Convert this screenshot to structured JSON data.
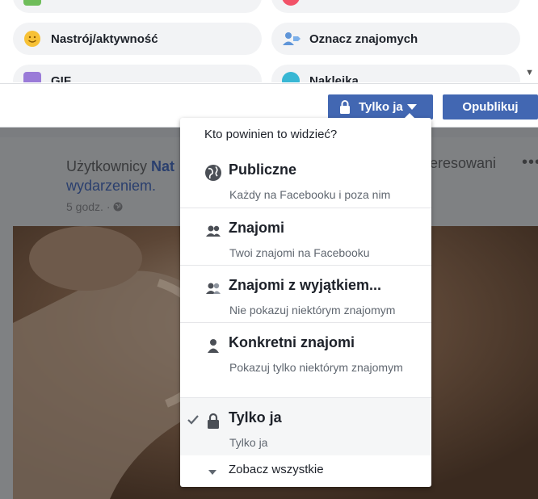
{
  "composer": {
    "options": [
      {
        "label": "",
        "icon": "activity-icon-partial"
      },
      {
        "label": "",
        "icon": "location-icon-partial"
      },
      {
        "label": "Nastrój/aktywność",
        "icon": "smiley-icon"
      },
      {
        "label": "Oznacz znajomych",
        "icon": "tag-friends-icon"
      },
      {
        "label": "GIF",
        "icon": "gif-icon"
      },
      {
        "label": "Naklejka",
        "icon": "sticker-icon"
      }
    ],
    "privacy_label": "Tylko ja",
    "publish_label": "Opublikuj"
  },
  "post": {
    "prefix": "Użytkownicy",
    "name_partial": "Nat",
    "suffix_partial": "eresowani",
    "line2": "wydarzeniem.",
    "time": "5 godz. ·"
  },
  "dropdown": {
    "header": "Kto powinien to widzieć?",
    "items": [
      {
        "title": "Publiczne",
        "desc": "Każdy na Facebooku i poza nim",
        "icon": "globe-icon",
        "selected": false
      },
      {
        "title": "Znajomi",
        "desc": "Twoi znajomi na Facebooku",
        "icon": "friends-icon",
        "selected": false
      },
      {
        "title": "Znajomi z wyjątkiem...",
        "desc": "Nie pokazuj niektórym znajomym",
        "icon": "friends-except-icon",
        "selected": false
      },
      {
        "title": "Konkretni znajomi",
        "desc": "Pokazuj tylko niektórym znajomym",
        "icon": "person-icon",
        "selected": false
      },
      {
        "title": "Tylko ja",
        "desc": "Tylko ja",
        "icon": "lock-icon",
        "selected": true
      }
    ],
    "see_all": "Zobacz wszystkie"
  },
  "colors": {
    "accent": "#4267b2",
    "overlay_bg": "#7b7d80"
  }
}
